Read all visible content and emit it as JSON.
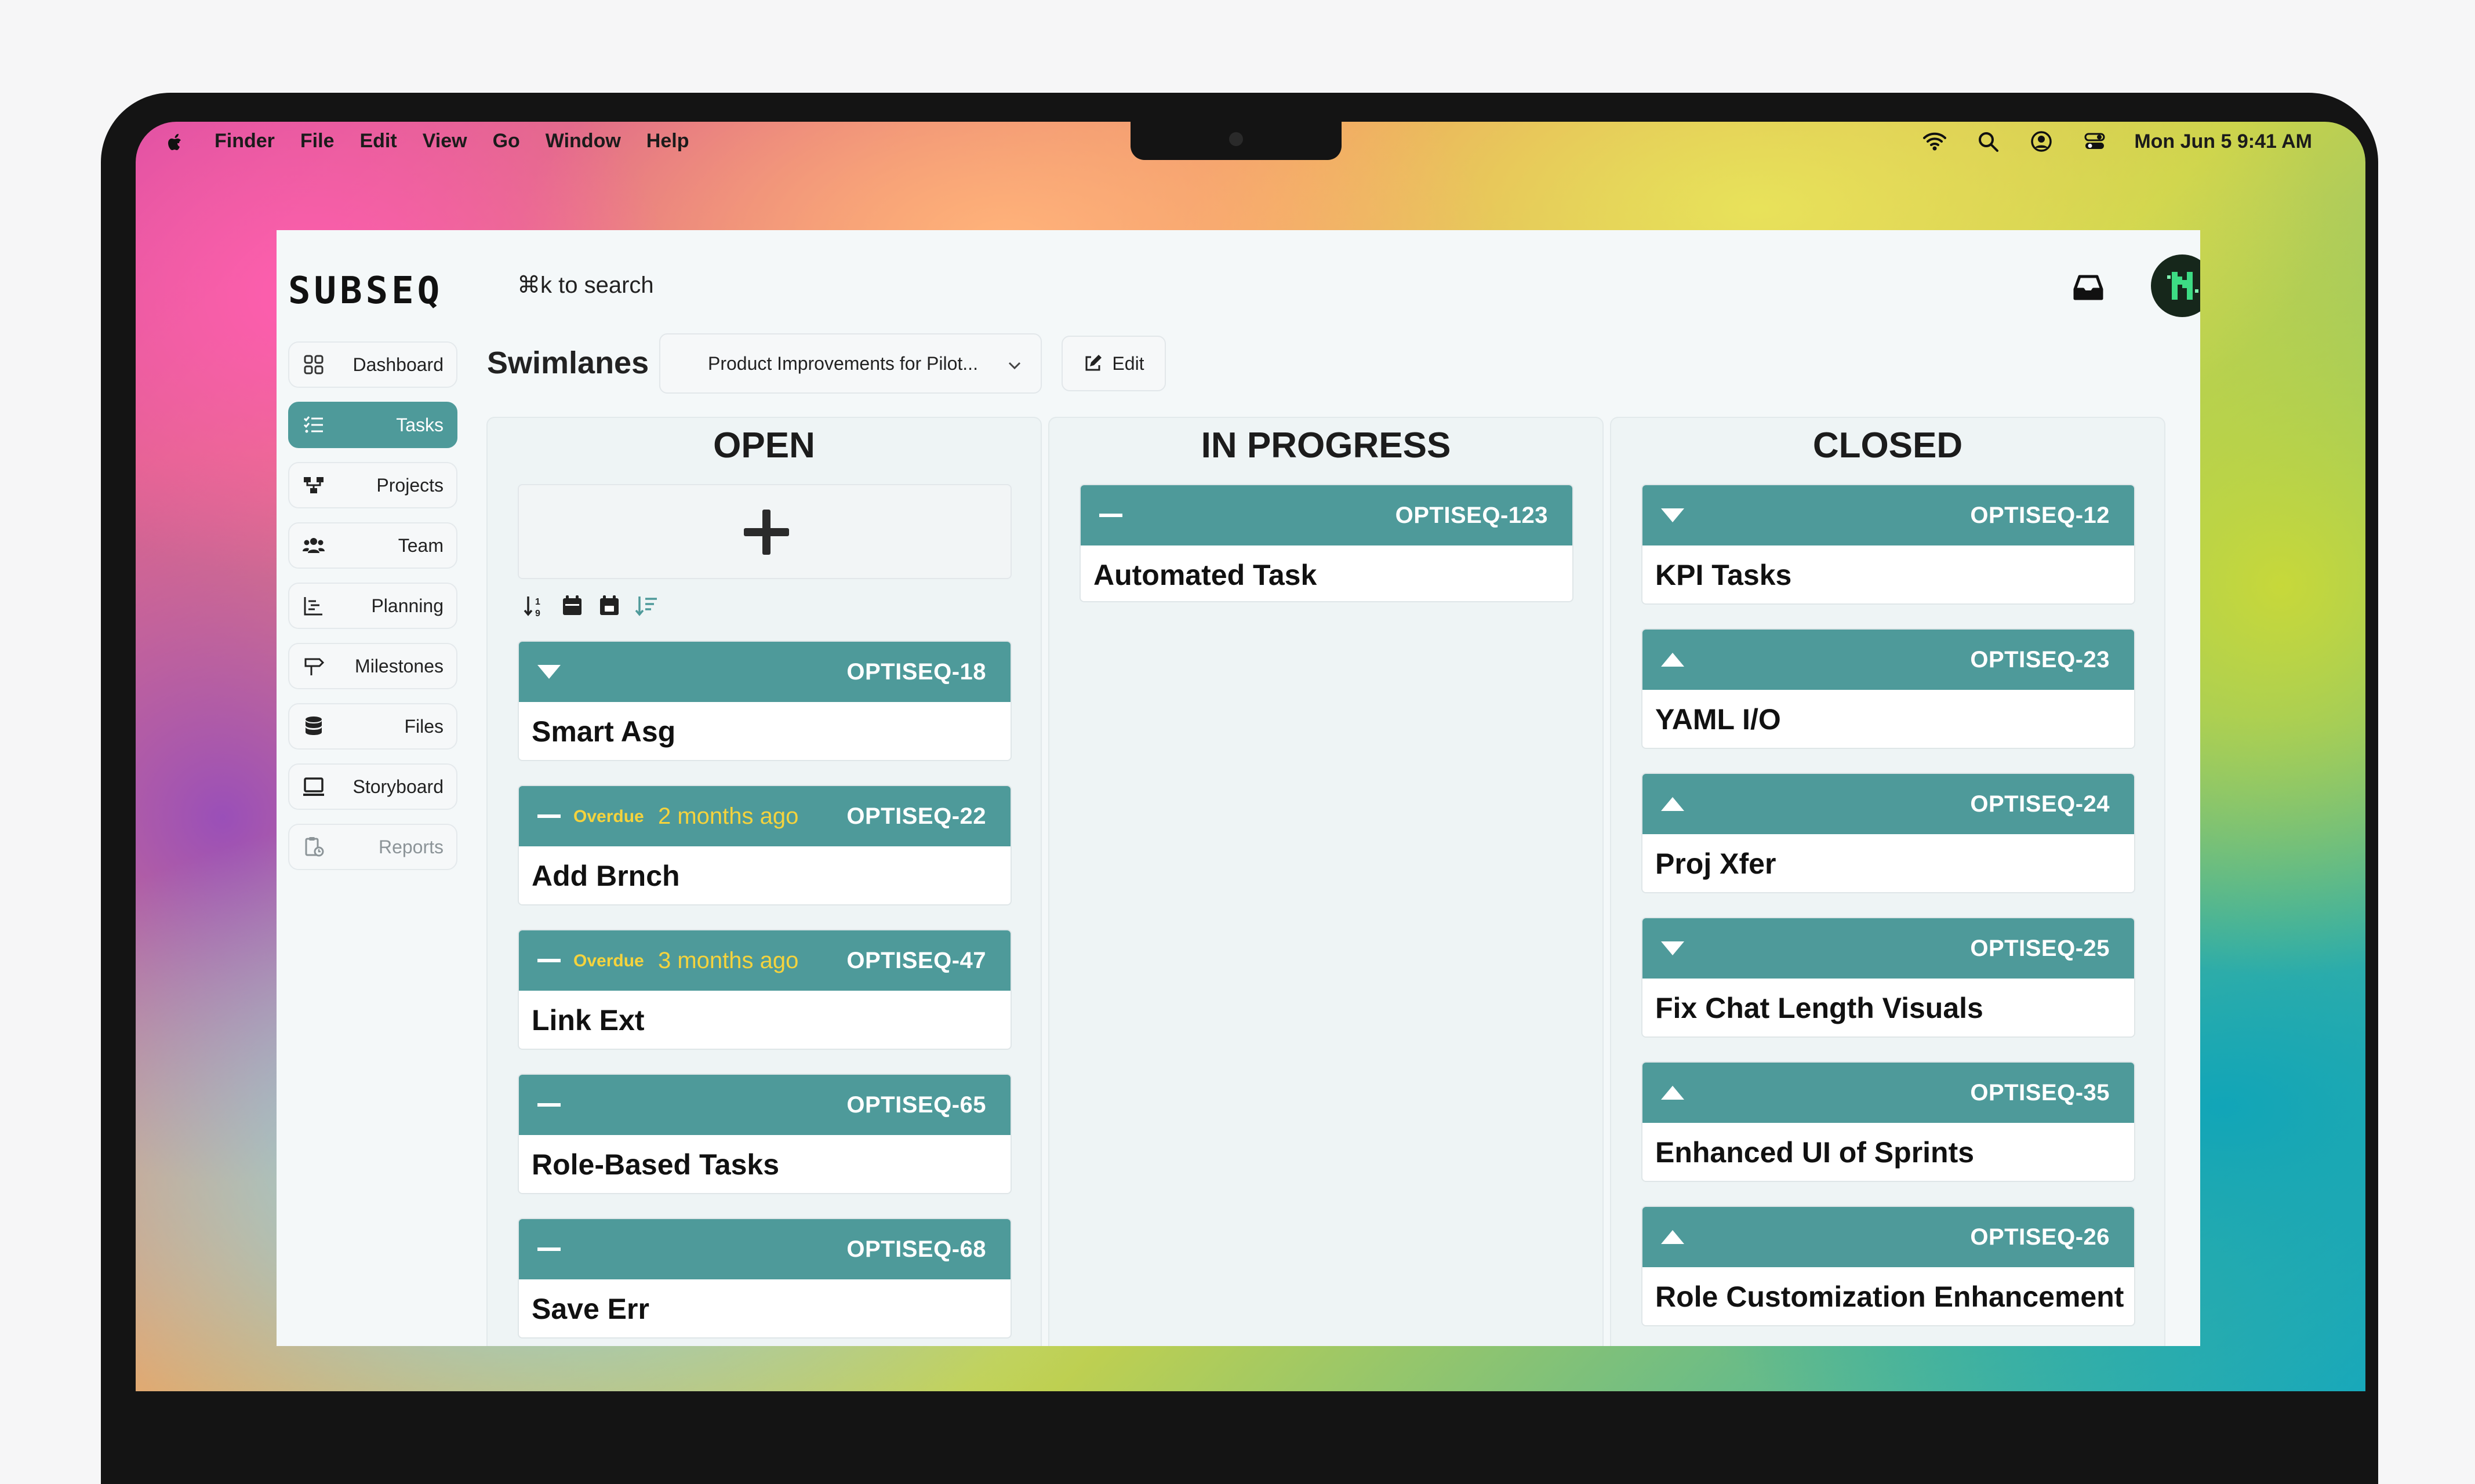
{
  "menubar": {
    "items": [
      "Finder",
      "File",
      "Edit",
      "View",
      "Go",
      "Window",
      "Help"
    ],
    "clock": "Mon Jun 5  9:41 AM",
    "status_icons": [
      "wifi-icon",
      "spotlight-icon",
      "user-icon",
      "control-center-icon"
    ]
  },
  "app": {
    "logo": "SUBSEQ",
    "search_hint": "⌘k to search"
  },
  "sidebar": {
    "items": [
      {
        "label": "Dashboard",
        "icon": "dashboard-icon",
        "state": "normal"
      },
      {
        "label": "Tasks",
        "icon": "tasks-icon",
        "state": "active"
      },
      {
        "label": "Projects",
        "icon": "projects-icon",
        "state": "normal"
      },
      {
        "label": "Team",
        "icon": "team-icon",
        "state": "normal"
      },
      {
        "label": "Planning",
        "icon": "planning-icon",
        "state": "normal"
      },
      {
        "label": "Milestones",
        "icon": "milestones-icon",
        "state": "normal"
      },
      {
        "label": "Files",
        "icon": "files-icon",
        "state": "normal"
      },
      {
        "label": "Storyboard",
        "icon": "storyboard-icon",
        "state": "normal"
      },
      {
        "label": "Reports",
        "icon": "reports-icon",
        "state": "disabled"
      }
    ]
  },
  "header": {
    "title": "Swimlanes",
    "project_select": "Product Improvements for Pilot...",
    "edit_label": "Edit"
  },
  "colors": {
    "accent": "#4e9a9a",
    "overdue": "#f5d33d",
    "lane_bg": "#eef4f5"
  },
  "lanes": {
    "open": {
      "title": "OPEN",
      "cards": [
        {
          "id": "OPTISEQ-18",
          "title": "Smart Asg",
          "priority": "down",
          "overdue": "",
          "ago": ""
        },
        {
          "id": "OPTISEQ-22",
          "title": "Add Brnch",
          "priority": "medium",
          "overdue": "Overdue",
          "ago": "2 months ago"
        },
        {
          "id": "OPTISEQ-47",
          "title": "Link Ext",
          "priority": "medium",
          "overdue": "Overdue",
          "ago": "3 months ago"
        },
        {
          "id": "OPTISEQ-65",
          "title": "Role-Based Tasks",
          "priority": "medium",
          "overdue": "",
          "ago": ""
        },
        {
          "id": "OPTISEQ-68",
          "title": "Save Err",
          "priority": "medium",
          "overdue": "",
          "ago": ""
        }
      ]
    },
    "in_progress": {
      "title": "IN PROGRESS",
      "cards": [
        {
          "id": "OPTISEQ-123",
          "title": "Automated Task",
          "priority": "medium"
        }
      ]
    },
    "closed": {
      "title": "CLOSED",
      "cards": [
        {
          "id": "OPTISEQ-12",
          "title": "KPI Tasks",
          "priority": "down"
        },
        {
          "id": "OPTISEQ-23",
          "title": "YAML I/O",
          "priority": "up"
        },
        {
          "id": "OPTISEQ-24",
          "title": "Proj Xfer",
          "priority": "up"
        },
        {
          "id": "OPTISEQ-25",
          "title": "Fix Chat Length Visuals",
          "priority": "down"
        },
        {
          "id": "OPTISEQ-35",
          "title": "Enhanced UI of Sprints",
          "priority": "up"
        },
        {
          "id": "OPTISEQ-26",
          "title": "Role Customization Enhancement",
          "priority": "up"
        }
      ]
    }
  }
}
